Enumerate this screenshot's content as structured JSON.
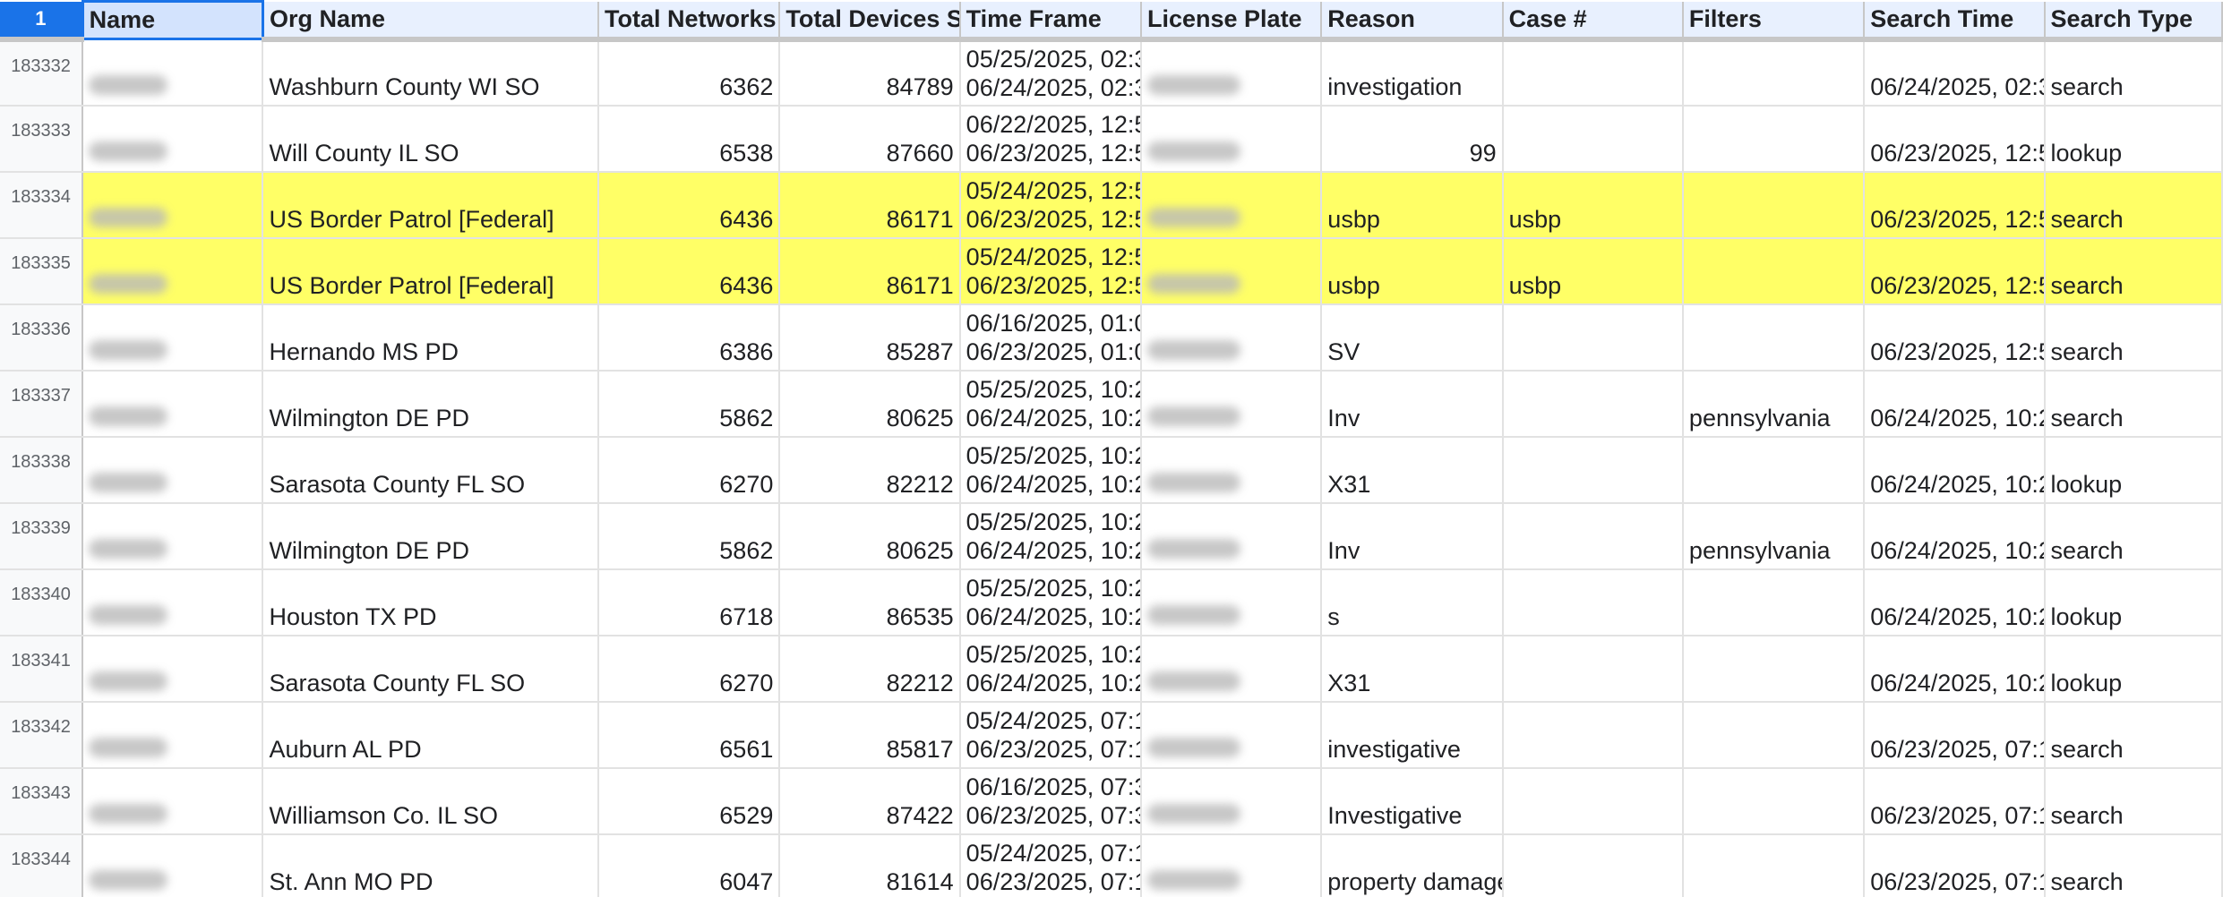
{
  "columns": {
    "row_corner": "1",
    "name": "Name",
    "org_name": "Org Name",
    "total_networks": "Total Networks",
    "total_devices": "Total Devices S",
    "time_frame": "Time Frame",
    "license_plate": "License Plate",
    "reason": "Reason",
    "case": "Case #",
    "filters": "Filters",
    "search_time": "Search Time",
    "search_type": "Search Type"
  },
  "rows": [
    {
      "row": "183332",
      "org": "Washburn County WI SO",
      "networks": "6362",
      "devices": "84789",
      "tf_start": "05/25/2025, 02:3",
      "tf_end": "06/24/2025, 02:3",
      "reason": "investigation",
      "case": "",
      "filters": "",
      "search_time": "06/24/2025, 02:3",
      "search_type": "search",
      "highlight": false
    },
    {
      "row": "183333",
      "org": "Will County IL SO",
      "networks": "6538",
      "devices": "87660",
      "tf_start": "06/22/2025, 12:5",
      "tf_end": "06/23/2025, 12:5",
      "reason": "99",
      "case": "",
      "filters": "",
      "search_time": "06/23/2025, 12:5",
      "search_type": "lookup",
      "highlight": false
    },
    {
      "row": "183334",
      "org": "US Border Patrol [Federal]",
      "networks": "6436",
      "devices": "86171",
      "tf_start": "05/24/2025, 12:5",
      "tf_end": "06/23/2025, 12:5",
      "reason": "usbp",
      "case": "usbp",
      "filters": "",
      "search_time": "06/23/2025, 12:5",
      "search_type": "search",
      "highlight": true
    },
    {
      "row": "183335",
      "org": "US Border Patrol [Federal]",
      "networks": "6436",
      "devices": "86171",
      "tf_start": "05/24/2025, 12:5",
      "tf_end": "06/23/2025, 12:5",
      "reason": "usbp",
      "case": "usbp",
      "filters": "",
      "search_time": "06/23/2025, 12:5",
      "search_type": "search",
      "highlight": true
    },
    {
      "row": "183336",
      "org": "Hernando MS PD",
      "networks": "6386",
      "devices": "85287",
      "tf_start": "06/16/2025, 01:0",
      "tf_end": "06/23/2025, 01:0",
      "reason": "SV",
      "case": "",
      "filters": "",
      "search_time": "06/23/2025, 12:5",
      "search_type": "search",
      "highlight": false
    },
    {
      "row": "183337",
      "org": "Wilmington DE PD",
      "networks": "5862",
      "devices": "80625",
      "tf_start": "05/25/2025, 10:2",
      "tf_end": "06/24/2025, 10:2",
      "reason": "Inv",
      "case": "",
      "filters": "pennsylvania",
      "search_time": "06/24/2025, 10:2",
      "search_type": "search",
      "highlight": false
    },
    {
      "row": "183338",
      "org": "Sarasota County FL SO",
      "networks": "6270",
      "devices": "82212",
      "tf_start": "05/25/2025, 10:2",
      "tf_end": "06/24/2025, 10:2",
      "reason": "X31",
      "case": "",
      "filters": "",
      "search_time": "06/24/2025, 10:2",
      "search_type": "lookup",
      "highlight": false
    },
    {
      "row": "183339",
      "org": "Wilmington DE PD",
      "networks": "5862",
      "devices": "80625",
      "tf_start": "05/25/2025, 10:2",
      "tf_end": "06/24/2025, 10:2",
      "reason": "Inv",
      "case": "",
      "filters": "pennsylvania",
      "search_time": "06/24/2025, 10:2",
      "search_type": "search",
      "highlight": false
    },
    {
      "row": "183340",
      "org": "Houston TX PD",
      "networks": "6718",
      "devices": "86535",
      "tf_start": "05/25/2025, 10:2",
      "tf_end": "06/24/2025, 10:2",
      "reason": "s",
      "case": "",
      "filters": "",
      "search_time": "06/24/2025, 10:2",
      "search_type": "lookup",
      "highlight": false
    },
    {
      "row": "183341",
      "org": "Sarasota County FL SO",
      "networks": "6270",
      "devices": "82212",
      "tf_start": "05/25/2025, 10:2",
      "tf_end": "06/24/2025, 10:2",
      "reason": "X31",
      "case": "",
      "filters": "",
      "search_time": "06/24/2025, 10:2",
      "search_type": "lookup",
      "highlight": false
    },
    {
      "row": "183342",
      "org": "Auburn AL PD",
      "networks": "6561",
      "devices": "85817",
      "tf_start": "05/24/2025, 07:1",
      "tf_end": "06/23/2025, 07:1",
      "reason": "investigative",
      "case": "",
      "filters": "",
      "search_time": "06/23/2025, 07:1",
      "search_type": "search",
      "highlight": false
    },
    {
      "row": "183343",
      "org": "Williamson Co. IL SO",
      "networks": "6529",
      "devices": "87422",
      "tf_start": "06/16/2025, 07:3",
      "tf_end": "06/23/2025, 07:3",
      "reason": "Investigative",
      "case": "",
      "filters": "",
      "search_time": "06/23/2025, 07:1",
      "search_type": "search",
      "highlight": false
    },
    {
      "row": "183344",
      "org": "St. Ann MO PD",
      "networks": "6047",
      "devices": "81614",
      "tf_start": "05/24/2025, 07:1",
      "tf_end": "06/23/2025, 07:1",
      "reason": "property damage",
      "case": "",
      "filters": "",
      "search_time": "06/23/2025, 07:1",
      "search_type": "search",
      "highlight": false
    }
  ]
}
